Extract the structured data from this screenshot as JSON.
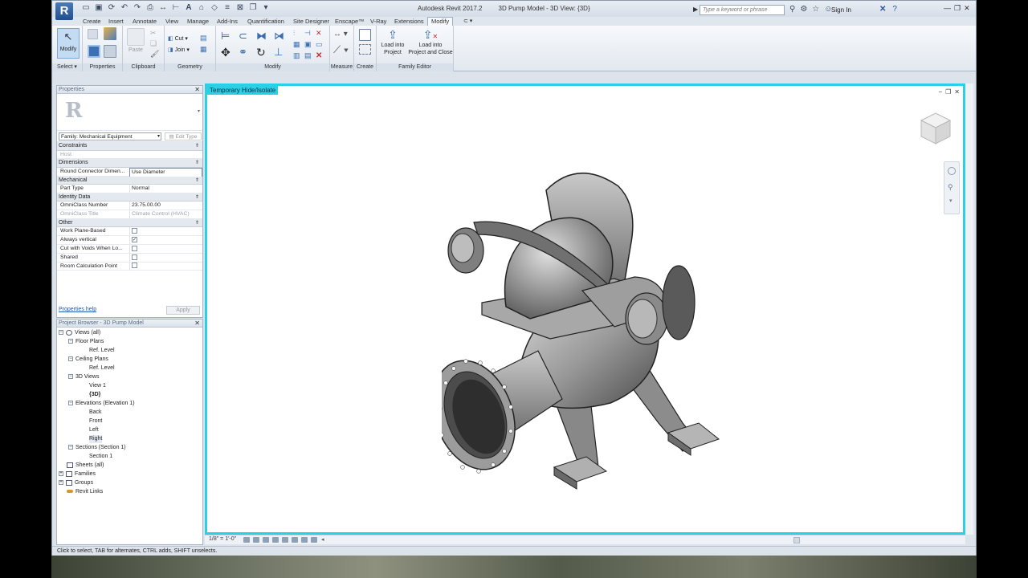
{
  "window": {
    "app_logo": "R",
    "app_title": "Autodesk Revit 2017.2",
    "document_title": "3D Pump Model - 3D View: {3D}",
    "search_placeholder": "Type a keyword or phrase",
    "sign_in": "Sign In"
  },
  "ribbon": {
    "tabs": [
      "Create",
      "Insert",
      "Annotate",
      "View",
      "Manage",
      "Add-Ins",
      "Quantification",
      "Site Designer",
      "Enscape™",
      "V-Ray",
      "Extensions",
      "Modify"
    ],
    "active_tab": "Modify",
    "modify_label": "Modify",
    "cut_label": "Cut",
    "join_label": "Join",
    "paste_label": "Paste",
    "load_into_project": "Load into\nProject",
    "load_into_project_close": "Load into\nProject and Close",
    "groups": {
      "select": "Select ▾",
      "properties": "Properties",
      "clipboard": "Clipboard",
      "geometry": "Geometry",
      "modify": "Modify",
      "measure": "Measure",
      "create": "Create",
      "family_editor": "Family Editor"
    }
  },
  "properties": {
    "title": "Properties",
    "family_selector": "Family: Mechanical Equipment",
    "edit_type": "Edit Type",
    "sections": {
      "constraints": "Constraints",
      "dimensions": "Dimensions",
      "mechanical": "Mechanical",
      "identity": "Identity Data",
      "other": "Other"
    },
    "rows": {
      "host": {
        "key": "Host",
        "value": ""
      },
      "round_connector": {
        "key": "Round Connector Dimen...",
        "value": "Use Diameter"
      },
      "part_type": {
        "key": "Part Type",
        "value": "Normal"
      },
      "omniclass_number": {
        "key": "OmniClass Number",
        "value": "23.75.00.00"
      },
      "omniclass_title": {
        "key": "OmniClass Title",
        "value": "Climate Control (HVAC)"
      },
      "work_plane": {
        "key": "Work Plane-Based",
        "checked": false
      },
      "always_vertical": {
        "key": "Always vertical",
        "checked": true
      },
      "cut_voids": {
        "key": "Cut with Voids When Lo...",
        "checked": false
      },
      "shared": {
        "key": "Shared",
        "checked": false
      },
      "room_calc": {
        "key": "Room Calculation Point",
        "checked": false
      }
    },
    "help_link": "Properties help",
    "apply": "Apply"
  },
  "browser": {
    "title": "Project Browser - 3D Pump Model",
    "items": {
      "views": "Views (all)",
      "floor_plans": "Floor Plans",
      "fp_ref": "Ref. Level",
      "ceiling_plans": "Ceiling Plans",
      "cp_ref": "Ref. Level",
      "views3d": "3D Views",
      "view1": "View 1",
      "view3d": "{3D}",
      "elevations": "Elevations (Elevation 1)",
      "back": "Back",
      "front": "Front",
      "left": "Left",
      "right": "Right",
      "sections": "Sections (Section 1)",
      "section1": "Section 1",
      "sheets": "Sheets (all)",
      "families": "Families",
      "groups": "Groups",
      "revit_links": "Revit Links"
    }
  },
  "view": {
    "banner": "Temporary Hide/Isolate",
    "scale": "1/8\" = 1'-0\""
  },
  "status_bar": "Click to select, TAB for alternates, CTRL adds, SHIFT unselects."
}
